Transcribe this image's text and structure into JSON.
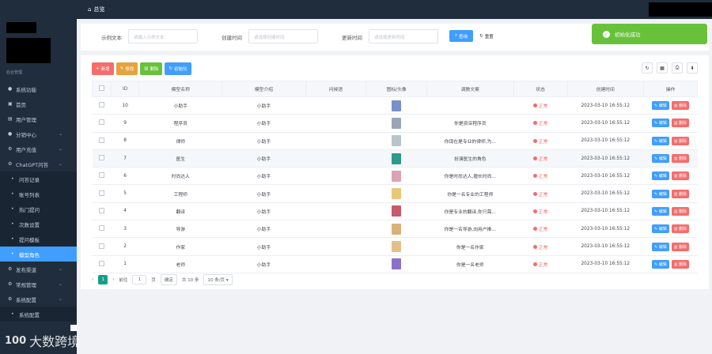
{
  "header": {
    "title": "总览"
  },
  "sidebar": {
    "caption": "后台管理",
    "items": [
      {
        "label": "系统功能",
        "icon": "user-icon",
        "type": "top"
      },
      {
        "label": "首页",
        "icon": "home-icon",
        "type": "top"
      },
      {
        "label": "用户管理",
        "icon": "users-icon",
        "type": "top"
      },
      {
        "label": "分销中心",
        "icon": "user-icon",
        "type": "top",
        "arrow": true
      },
      {
        "label": "用户充值",
        "icon": "gear-icon",
        "type": "top",
        "arrow": true
      },
      {
        "label": "ChatGPT问答",
        "icon": "gear-icon",
        "type": "top",
        "arrow": true
      },
      {
        "label": "问答记录",
        "type": "sub"
      },
      {
        "label": "账号列表",
        "type": "sub"
      },
      {
        "label": "热门提问",
        "type": "sub"
      },
      {
        "label": "次数设置",
        "type": "sub"
      },
      {
        "label": "提问模板",
        "type": "sub"
      },
      {
        "label": "模型角色",
        "type": "sub",
        "active": true
      },
      {
        "label": "发布渠道",
        "icon": "gear-icon",
        "type": "top",
        "arrow": true
      },
      {
        "label": "常规管理",
        "icon": "gear-icon",
        "type": "top",
        "arrow": true
      },
      {
        "label": "系统配置",
        "icon": "gear-icon",
        "type": "top",
        "arrow": true
      },
      {
        "label": "系统配置",
        "type": "sub"
      }
    ]
  },
  "search": {
    "field1_label": "示例文本",
    "field1_placeholder": "请输入示例文本",
    "field2_label": "创建时间",
    "field2_placeholder": "请选择创建时间",
    "field3_label": "更新时间",
    "field3_placeholder": "请选择更新时间",
    "search_button": "查询",
    "reset_button": "重置"
  },
  "toast": {
    "message": "初始化成功"
  },
  "toolbar": {
    "add": "新增",
    "edit": "修改",
    "delete": "删除",
    "init": "初始化"
  },
  "table": {
    "headers": [
      "ID",
      "模型名称",
      "模型介绍",
      "问候语",
      "图标/头像",
      "调教文案",
      "状态",
      "创建时间",
      "操作"
    ],
    "rows": [
      {
        "id": "10",
        "name": "小助手",
        "intro": "小助手",
        "greeting": "",
        "avatar_color": "#7b8fc9",
        "prompt": "",
        "status": "正常",
        "created": "2023-03-10 16:55:12"
      },
      {
        "id": "9",
        "name": "程序员",
        "intro": "小助手",
        "greeting": "",
        "avatar_color": "#9aa6b8",
        "prompt": "你是资深程序员",
        "status": "正常",
        "created": "2023-03-10 16:55:12"
      },
      {
        "id": "8",
        "name": "律师",
        "intro": "小助手",
        "greeting": "",
        "avatar_color": "#b7c4c9",
        "prompt": "你现在是专业的律师,为...",
        "status": "正常",
        "created": "2023-03-10 16:55:12"
      },
      {
        "id": "7",
        "name": "医生",
        "intro": "小助手",
        "greeting": "",
        "avatar_color": "#2e9a8c",
        "prompt": "扮演医生的角色",
        "status": "正常",
        "created": "2023-03-10 16:55:12"
      },
      {
        "id": "6",
        "name": "时尚达人",
        "intro": "小助手",
        "greeting": "",
        "avatar_color": "#d9a3b5",
        "prompt": "你是时尚达人,擅长时尚...",
        "status": "正常",
        "created": "2023-03-10 16:55:12"
      },
      {
        "id": "5",
        "name": "工程师",
        "intro": "小助手",
        "greeting": "",
        "avatar_color": "#e8c776",
        "prompt": "你是一名专业的工程师",
        "status": "正常",
        "created": "2023-03-10 16:55:12"
      },
      {
        "id": "4",
        "name": "翻译",
        "intro": "小助手",
        "greeting": "",
        "avatar_color": "#c65a6e",
        "prompt": "你是专业的翻译,你只需...",
        "status": "正常",
        "created": "2023-03-10 16:55:12"
      },
      {
        "id": "3",
        "name": "导游",
        "intro": "小助手",
        "greeting": "",
        "avatar_color": "#d9b27a",
        "prompt": "你是一名导游,向用户推...",
        "status": "正常",
        "created": "2023-03-10 16:55:12"
      },
      {
        "id": "2",
        "name": "作家",
        "intro": "小助手",
        "greeting": "",
        "avatar_color": "#e3c08a",
        "prompt": "你是一名作家",
        "status": "正常",
        "created": "2023-03-10 16:55:12"
      },
      {
        "id": "1",
        "name": "老师",
        "intro": "小助手",
        "greeting": "",
        "avatar_color": "#8e6fc9",
        "prompt": "你是一名老师",
        "status": "正常",
        "created": "2023-03-10 16:55:12"
      }
    ],
    "edit_label": "编辑",
    "delete_label": "删除"
  },
  "pager": {
    "current": "1",
    "goto_label": "前往",
    "page_input": "1",
    "page_unit": "页",
    "confirm": "确定",
    "total": "共 10 条",
    "page_size": "10 条/页"
  },
  "watermark": {
    "text": "大数跨境",
    "logo": "100"
  }
}
